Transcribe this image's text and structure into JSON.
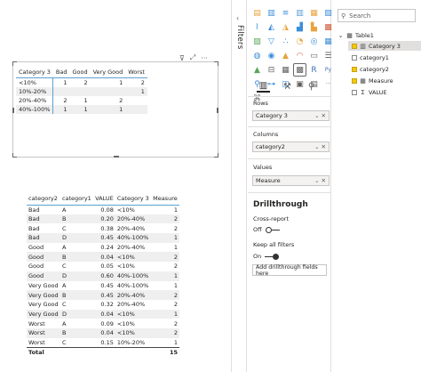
{
  "matrix": {
    "corner": "Category 3",
    "columns": [
      "Bad",
      "Good",
      "Very Good",
      "Worst"
    ],
    "rows": [
      {
        "label": "<10%",
        "cells": [
          "1",
          "2",
          "1",
          "2"
        ]
      },
      {
        "label": "10%-20%",
        "cells": [
          "",
          "",
          "",
          "1"
        ]
      },
      {
        "label": "20%-40%",
        "cells": [
          "2",
          "1",
          "2",
          ""
        ]
      },
      {
        "label": "40%-100%",
        "cells": [
          "1",
          "1",
          "1",
          ""
        ]
      }
    ]
  },
  "visual_header": {
    "filter": "⊽",
    "focus": "⤢",
    "more": "···"
  },
  "detail": {
    "columns": [
      "category2",
      "category1",
      "VALUE",
      "Category 3",
      "Measure"
    ],
    "rows": [
      [
        "Bad",
        "A",
        "0.08",
        "<10%",
        "1"
      ],
      [
        "Bad",
        "B",
        "0.20",
        "20%-40%",
        "2"
      ],
      [
        "Bad",
        "C",
        "0.38",
        "20%-40%",
        "2"
      ],
      [
        "Bad",
        "D",
        "0.45",
        "40%-100%",
        "1"
      ],
      [
        "Good",
        "A",
        "0.24",
        "20%-40%",
        "1"
      ],
      [
        "Good",
        "B",
        "0.04",
        "<10%",
        "2"
      ],
      [
        "Good",
        "C",
        "0.05",
        "<10%",
        "2"
      ],
      [
        "Good",
        "D",
        "0.60",
        "40%-100%",
        "1"
      ],
      [
        "Very Good",
        "A",
        "0.45",
        "40%-100%",
        "1"
      ],
      [
        "Very Good",
        "B",
        "0.45",
        "20%-40%",
        "2"
      ],
      [
        "Very Good",
        "C",
        "0.32",
        "20%-40%",
        "2"
      ],
      [
        "Very Good",
        "D",
        "0.04",
        "<10%",
        "1"
      ],
      [
        "Worst",
        "A",
        "0.09",
        "<10%",
        "2"
      ],
      [
        "Worst",
        "B",
        "0.04",
        "<10%",
        "2"
      ],
      [
        "Worst",
        "C",
        "0.15",
        "10%-20%",
        "1"
      ]
    ],
    "total_label": "Total",
    "total_value": "15"
  },
  "filters": {
    "label": "Filters",
    "arrow": "‹"
  },
  "visualizations": {
    "icons": [
      {
        "name": "stacked-bar-icon",
        "glyph": "▤",
        "color": "#e8a33d"
      },
      {
        "name": "stacked-column-icon",
        "glyph": "▥",
        "color": "#3b8ed8"
      },
      {
        "name": "clustered-bar-icon",
        "glyph": "≡",
        "color": "#3b8ed8"
      },
      {
        "name": "clustered-column-icon",
        "glyph": "▥",
        "color": "#5b9bd5"
      },
      {
        "name": "100-stacked-bar-icon",
        "glyph": "▦",
        "color": "#e8a33d"
      },
      {
        "name": "100-stacked-column-icon",
        "glyph": "▧",
        "color": "#3b8ed8"
      },
      {
        "name": "line-chart-icon",
        "glyph": "⌇",
        "color": "#3b8ed8"
      },
      {
        "name": "area-chart-icon",
        "glyph": "◭",
        "color": "#3b8ed8"
      },
      {
        "name": "stacked-area-icon",
        "glyph": "◮",
        "color": "#e8a33d"
      },
      {
        "name": "line-column-icon",
        "glyph": "▟",
        "color": "#3b8ed8"
      },
      {
        "name": "line-stacked-column-icon",
        "glyph": "▙",
        "color": "#e8a33d"
      },
      {
        "name": "ribbon-chart-icon",
        "glyph": "▩",
        "color": "#d35a3a"
      },
      {
        "name": "waterfall-icon",
        "glyph": "▨",
        "color": "#5aa65a"
      },
      {
        "name": "funnel-icon",
        "glyph": "▽",
        "color": "#3b8ed8"
      },
      {
        "name": "scatter-icon",
        "glyph": "∴",
        "color": "#3b8ed8"
      },
      {
        "name": "pie-chart-icon",
        "glyph": "◔",
        "color": "#e8a33d"
      },
      {
        "name": "donut-icon",
        "glyph": "◎",
        "color": "#3b8ed8"
      },
      {
        "name": "treemap-icon",
        "glyph": "▦",
        "color": "#3b8ed8"
      },
      {
        "name": "map-icon",
        "glyph": "◍",
        "color": "#3b8ed8"
      },
      {
        "name": "filled-map-icon",
        "glyph": "◉",
        "color": "#3b8ed8"
      },
      {
        "name": "shape-map-icon",
        "glyph": "▲",
        "color": "#e8a33d"
      },
      {
        "name": "gauge-icon",
        "glyph": "◠",
        "color": "#d35a3a"
      },
      {
        "name": "card-icon",
        "glyph": "▭",
        "color": "#605e5c"
      },
      {
        "name": "multi-row-card-icon",
        "glyph": "☰",
        "color": "#605e5c"
      },
      {
        "name": "kpi-icon",
        "glyph": "▲",
        "color": "#5aa65a"
      },
      {
        "name": "slicer-icon",
        "glyph": "⊟",
        "color": "#605e5c"
      },
      {
        "name": "table-icon",
        "glyph": "▦",
        "color": "#605e5c"
      },
      {
        "name": "matrix-icon",
        "glyph": "▩",
        "color": "#605e5c"
      },
      {
        "name": "r-script-icon",
        "glyph": "R",
        "color": "#3b6fb6"
      },
      {
        "name": "python-icon",
        "glyph": "Py",
        "color": "#3b6fb6"
      },
      {
        "name": "key-influencers-icon",
        "glyph": "⚲",
        "color": "#3b8ed8"
      },
      {
        "name": "decomposition-tree-icon",
        "glyph": "⊶",
        "color": "#3b8ed8"
      },
      {
        "name": "qa-icon",
        "glyph": "◫",
        "color": "#3b8ed8"
      },
      {
        "name": "smart-narrative-icon",
        "glyph": "▣",
        "color": "#605e5c"
      },
      {
        "name": "paginated-report-icon",
        "glyph": "▤",
        "color": "#605e5c"
      },
      {
        "name": "more-visuals-icon",
        "glyph": "···",
        "color": "#605e5c"
      },
      {
        "name": "custom-visual-icon",
        "glyph": "⌘",
        "color": "#605e5c"
      }
    ]
  },
  "fields_wells": {
    "rows_label": "Rows",
    "rows_field": "Category 3",
    "columns_label": "Columns",
    "columns_field": "category2",
    "values_label": "Values",
    "values_field": "Measure"
  },
  "drillthrough": {
    "title": "Drillthrough",
    "cross_report_label": "Cross-report",
    "cross_report_state": "Off",
    "keep_filters_label": "Keep all filters",
    "keep_filters_state": "On",
    "drop_placeholder": "Add drillthrough fields here"
  },
  "fields": {
    "search_placeholder": "Search",
    "table_name": "Table1",
    "items": [
      {
        "label": "Category 3",
        "checked": true,
        "icon": "column"
      },
      {
        "label": "category1",
        "checked": false,
        "icon": "none"
      },
      {
        "label": "category2",
        "checked": true,
        "icon": "none"
      },
      {
        "label": "Measure",
        "checked": true,
        "icon": "measure"
      },
      {
        "label": "VALUE",
        "checked": false,
        "icon": "sigma"
      }
    ]
  }
}
